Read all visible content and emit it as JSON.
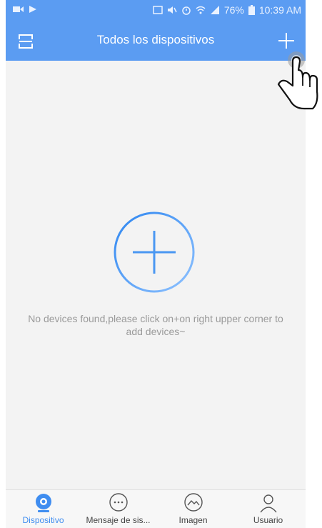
{
  "status_bar": {
    "battery_percent": "76%",
    "time": "10:39 AM"
  },
  "app_bar": {
    "title": "Todos los dispositivos",
    "left_icon": "scan-icon",
    "right_icon": "plus-icon"
  },
  "content": {
    "add_icon": "circle-plus-icon",
    "empty_message": "No devices found,please click on+on right upper corner to add devices~"
  },
  "tabs": [
    {
      "label": "Dispositivo",
      "icon": "camera-icon",
      "active": true
    },
    {
      "label": "Mensaje de sis...",
      "icon": "message-icon",
      "active": false
    },
    {
      "label": "Imagen",
      "icon": "image-icon",
      "active": false
    },
    {
      "label": "Usuario",
      "icon": "user-icon",
      "active": false
    }
  ],
  "colors": {
    "header": "#5b9cf2",
    "accent": "#3f8df0",
    "background": "#f3f3f3"
  }
}
